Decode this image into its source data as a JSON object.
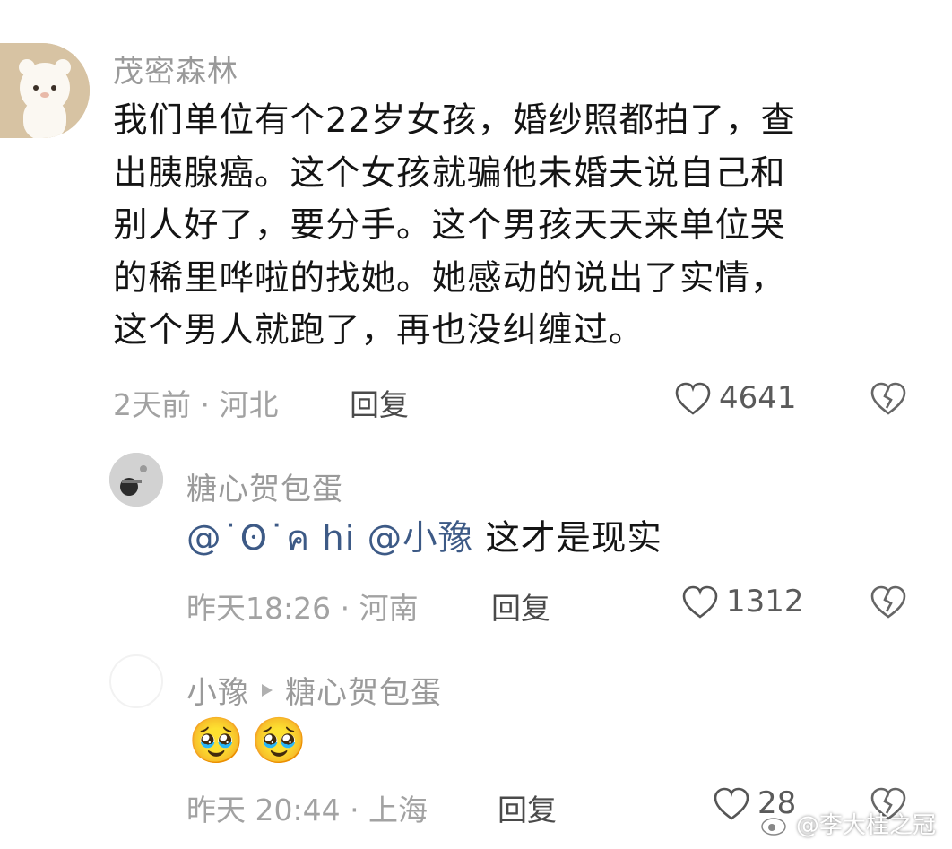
{
  "comments": [
    {
      "username": "茂密森林",
      "text_lines": [
        "我们单位有个22岁女孩，婚纱照都拍了，查",
        "出胰腺癌。这个女孩就骗他未婚夫说自己和",
        "别人好了，要分手。这个男孩天天来单位哭",
        "的稀里哗啦的找她。她感动的说出了实情，",
        "这个男人就跑了，再也没纠缠过。"
      ],
      "meta": "2天前 · 河北",
      "reply_label": "回复",
      "likes": "4641"
    },
    {
      "username": "糖心贺包蛋",
      "mention": "@˙ʘ˙ค hi @小豫",
      "text": "这才是现实",
      "meta": "昨天18:26 · 河南",
      "reply_label": "回复",
      "likes": "1312"
    },
    {
      "username": "小豫",
      "reply_to": "糖心贺包蛋",
      "emoji": "🥹🥹",
      "meta": "昨天 20:44 · 上海",
      "reply_label": "回复",
      "likes": "28"
    }
  ],
  "watermark": "@李大桂之冠",
  "colors": {
    "username": "#9a9a9a",
    "text": "#141414",
    "mention": "#3d5a86",
    "meta": "#a2a2a2"
  },
  "icons": [
    "heart-outline-icon",
    "broken-heart-icon",
    "triangle-right-icon",
    "weibo-logo-icon"
  ]
}
